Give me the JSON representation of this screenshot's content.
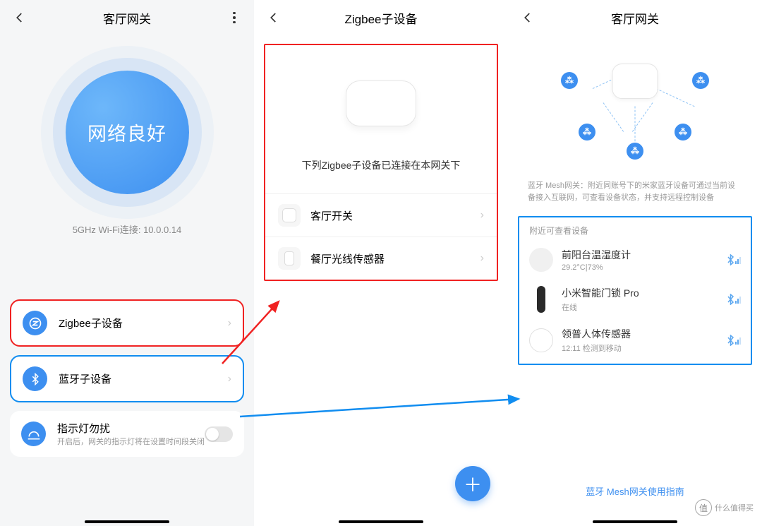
{
  "panel1": {
    "title": "客厅网关",
    "status_text": "网络良好",
    "wifi_info": "5GHz Wi-Fi连接: 10.0.0.14",
    "zigbee_item": "Zigbee子设备",
    "bluetooth_item": "蓝牙子设备",
    "dnd_title": "指示灯勿扰",
    "dnd_sub": "开启后，网关的指示灯将在设置时间段关闭"
  },
  "panel2": {
    "title": "Zigbee子设备",
    "desc": "下列Zigbee子设备已连接在本网关下",
    "items": [
      {
        "name": "客厅开关"
      },
      {
        "name": "餐厅光线传感器"
      }
    ]
  },
  "panel3": {
    "title": "客厅网关",
    "desc": "蓝牙 Mesh网关：附近同账号下的米家蓝牙设备可通过当前设备接入互联网，可查看设备状态，并支持远程控制设备",
    "box_title": "附近可查看设备",
    "items": [
      {
        "name": "前阳台温湿度计",
        "sub": "29.2°C|73%"
      },
      {
        "name": "小米智能门锁 Pro",
        "sub": "在线"
      },
      {
        "name": "领普人体传感器",
        "sub": "12:11 检测到移动"
      }
    ],
    "guide_link": "蓝牙 Mesh网关使用指南"
  },
  "watermark": {
    "icon_text": "值",
    "text": "什么值得买"
  }
}
